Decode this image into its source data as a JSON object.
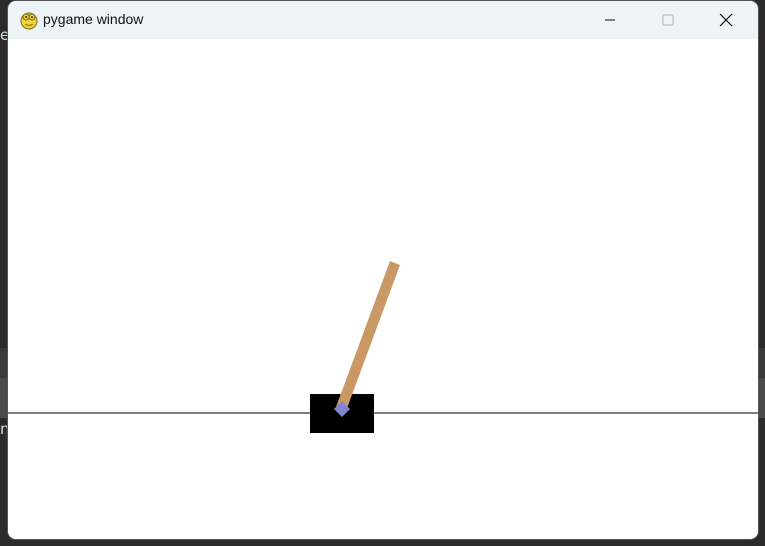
{
  "window": {
    "title": "pygame window",
    "icon": "pygame-snake-icon",
    "controls": {
      "minimize": "minimize-icon",
      "maximize": "maximize-icon",
      "close": "close-icon"
    }
  },
  "background": {
    "left_chars": [
      "e",
      "n"
    ]
  },
  "scene": {
    "cart_color": "#000000",
    "pole_color": "#ca9865",
    "axle_color": "#8184cb",
    "track_color": "#000000"
  }
}
